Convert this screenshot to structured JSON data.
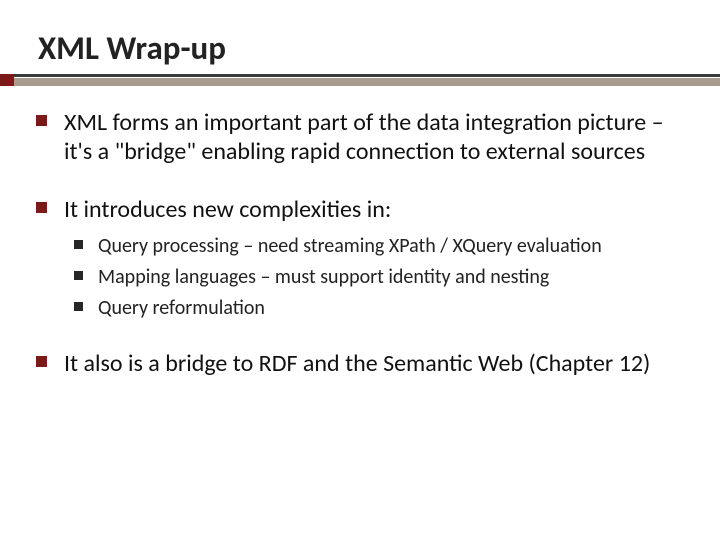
{
  "title": "XML Wrap-up",
  "bullets": {
    "b1": "XML forms an important part of the data integration picture – it's a \"bridge\" enabling rapid connection to external sources",
    "b2": "It introduces new complexities in:",
    "b2sub": {
      "s1": "Query processing – need streaming XPath / XQuery evaluation",
      "s2": "Mapping languages – must support identity and nesting",
      "s3": "Query reformulation"
    },
    "b3": "It also is a bridge to RDF and the Semantic Web (Chapter 12)"
  }
}
